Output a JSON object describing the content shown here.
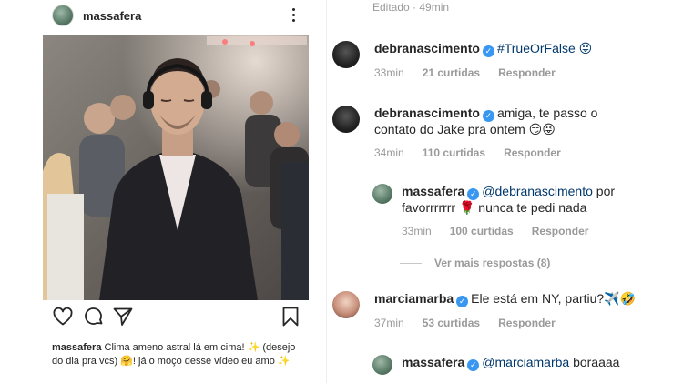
{
  "post": {
    "username": "massafera",
    "caption_username": "massafera",
    "caption_text": " Clima ameno astral lá em cima! ✨ (desejo do dia pra vcs) 🤗! já o moço desse vídeo eu amo ✨"
  },
  "comments_panel": {
    "edited": "Editado · 49min",
    "view_more": "Ver mais respostas (8)",
    "comments": [
      {
        "username": "debranascimento",
        "verified": true,
        "text": "#TrueOrFalse 😛",
        "time": "33min",
        "likes": "21 curtidas",
        "reply": "Responder"
      },
      {
        "username": "debranascimento",
        "verified": true,
        "text": "amiga, te passo o contato do Jake pra ontem 😏😜",
        "time": "34min",
        "likes": "110 curtidas",
        "reply": "Responder"
      },
      {
        "username": "massafera",
        "verified": true,
        "mention": "@debranascimento",
        "text": " por favorrrrrrr 🌹 nunca te pedi nada",
        "time": "33min",
        "likes": "100 curtidas",
        "reply": "Responder"
      },
      {
        "username": "marciamarba",
        "verified": true,
        "text": "Ele está em NY, partiu?✈️🤣",
        "time": "37min",
        "likes": "53 curtidas",
        "reply": "Responder"
      },
      {
        "username": "massafera",
        "verified": true,
        "mention": "@marciamarba",
        "text": " boraaaa"
      }
    ]
  },
  "icons": {
    "more": "more-horizontal-icon",
    "like": "heart-icon",
    "comment": "comment-bubble-icon",
    "share": "send-icon",
    "save": "bookmark-icon",
    "verified": "verified-badge-icon"
  },
  "colors": {
    "text": "#262626",
    "secondary": "#9a9a9a",
    "verified": "#3897f0",
    "mention": "#00376b"
  }
}
